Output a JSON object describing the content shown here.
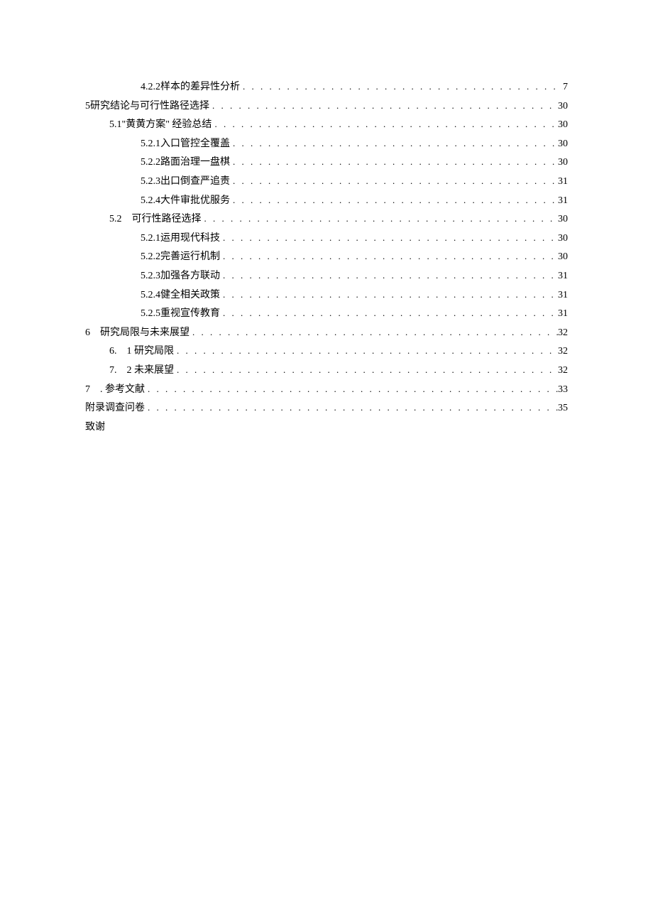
{
  "toc": [
    {
      "level": 2,
      "number": "4.2.2",
      "title": "样本的差异性分析",
      "page": "7",
      "unspaced_number": true
    },
    {
      "level": 0,
      "number": "5",
      "title": "研究结论与可行性路径选择",
      "page": "30",
      "unspaced_number": true
    },
    {
      "level": 1,
      "number": "5.1",
      "title": "\"黄黄方案\" 经验总结",
      "page": "30",
      "unspaced_number": true
    },
    {
      "level": 2,
      "number": "5.2.1",
      "title": "入口管控全覆盖",
      "page": "30"
    },
    {
      "level": 2,
      "number": "5.2.2",
      "title": "路面治理一盘棋",
      "page": "30"
    },
    {
      "level": 2,
      "number": "5.2.3",
      "title": "出口倒查严追责",
      "page": "31"
    },
    {
      "level": 2,
      "number": "5.2.4",
      "title": "大件审批优服务",
      "page": "31"
    },
    {
      "level": 1,
      "number": "5.2",
      "title": "可行性路径选择",
      "page": "30"
    },
    {
      "level": 2,
      "number": "5.2.1",
      "title": "运用现代科技",
      "page": "30"
    },
    {
      "level": 2,
      "number": "5.2.2",
      "title": "完善运行机制",
      "page": "30"
    },
    {
      "level": 2,
      "number": "5.2.3",
      "title": "加强各方联动",
      "page": "31"
    },
    {
      "level": 2,
      "number": "5.2.4",
      "title": "健全相关政策",
      "page": "31"
    },
    {
      "level": 2,
      "number": "5.2.5",
      "title": "重视宣传教育",
      "page": "31"
    },
    {
      "level": 0,
      "number": "6",
      "title": "研究局限与未来展望",
      "page": "32"
    },
    {
      "level": 1,
      "number": "6.",
      "title": "1 研究局限",
      "page": "32",
      "num_in_title": true
    },
    {
      "level": 1,
      "number": "7.",
      "title": "2 未来展望",
      "page": "32",
      "num_in_title": true
    },
    {
      "level": 0,
      "number": "7",
      "title": ". 参考文献",
      "page": "33",
      "num_in_title": true
    },
    {
      "level": 0,
      "number": "",
      "title": "附录调查问卷",
      "page": "35"
    },
    {
      "level": 0,
      "number": "",
      "title": "致谢",
      "page": "",
      "no_page": true
    }
  ]
}
